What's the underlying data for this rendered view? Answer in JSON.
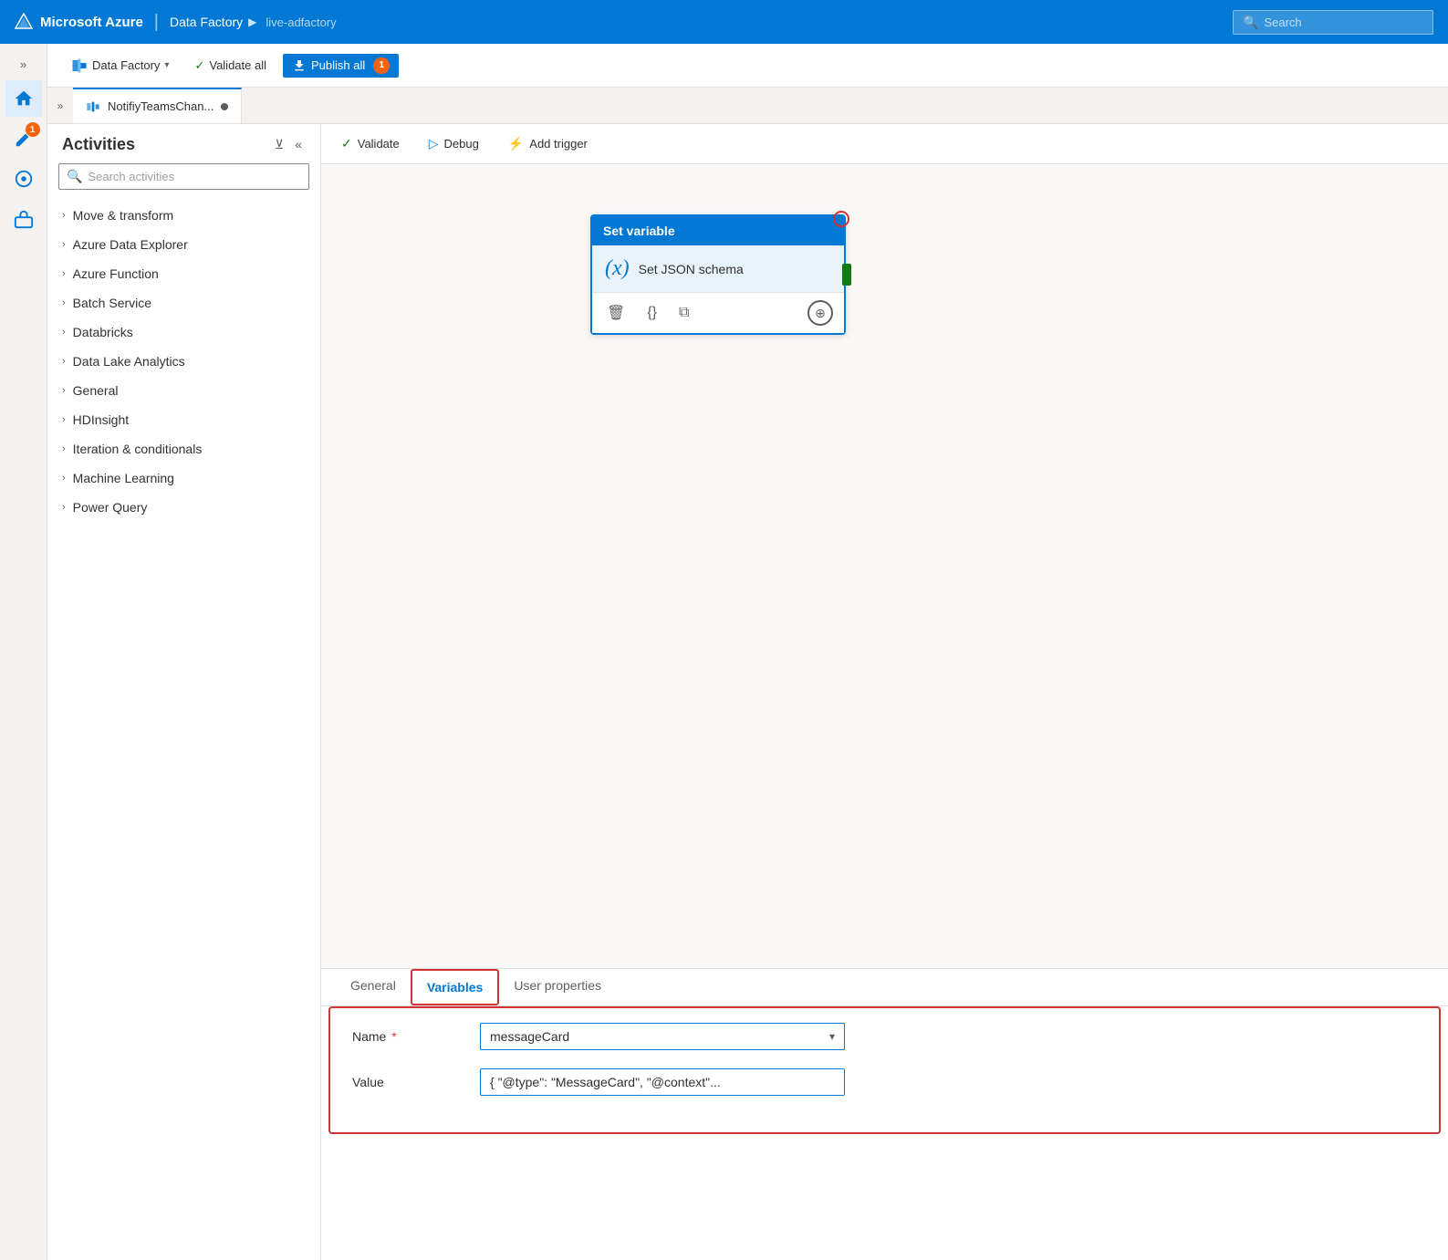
{
  "topNav": {
    "brand": "Microsoft Azure",
    "separator": "|",
    "dataFactory": "Data Factory",
    "chevron": "▶",
    "instance": "live-adfactory",
    "search": {
      "placeholder": "Search"
    }
  },
  "toolbar": {
    "dataFactory": "Data Factory",
    "validateAll": "Validate all",
    "publishAll": "Publish all",
    "publishBadge": "1"
  },
  "tab": {
    "name": "NotifiyTeamsChan..."
  },
  "canvasToolbar": {
    "validate": "Validate",
    "debug": "Debug",
    "addTrigger": "Add trigger"
  },
  "activities": {
    "title": "Activities",
    "searchPlaceholder": "Search activities",
    "groups": [
      {
        "label": "Move & transform"
      },
      {
        "label": "Azure Data Explorer"
      },
      {
        "label": "Azure Function"
      },
      {
        "label": "Batch Service"
      },
      {
        "label": "Databricks"
      },
      {
        "label": "Data Lake Analytics"
      },
      {
        "label": "General"
      },
      {
        "label": "HDInsight"
      },
      {
        "label": "Iteration & conditionals"
      },
      {
        "label": "Machine Learning"
      },
      {
        "label": "Power Query"
      }
    ]
  },
  "activityCard": {
    "header": "Set variable",
    "icon": "(x)",
    "name": "Set JSON schema",
    "actions": {
      "delete": "🗑",
      "code": "{}",
      "copy": "⧉",
      "add": "⊕"
    }
  },
  "bottomPanel": {
    "tabs": [
      {
        "label": "General",
        "active": false
      },
      {
        "label": "Variables",
        "active": true
      },
      {
        "label": "User properties",
        "active": false
      }
    ],
    "fields": {
      "nameLabel": "Name",
      "nameRequired": "*",
      "nameValue": "messageCard",
      "valueLabel": "Value",
      "valueContent": "{ \"@type\": \"MessageCard\", \"@context\"..."
    }
  },
  "sidebarIcons": {
    "home": "🏠",
    "edit_badge": "1",
    "monitor": "⊙",
    "toolbox": "🧰"
  }
}
